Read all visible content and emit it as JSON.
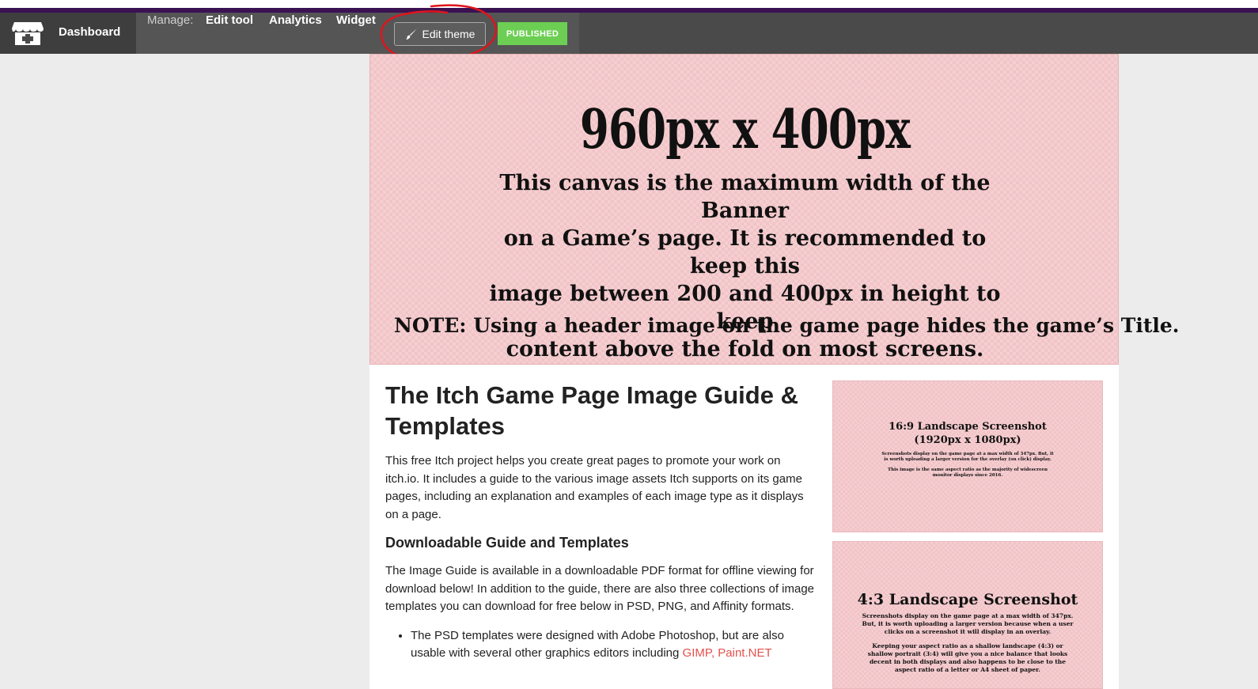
{
  "navbar": {
    "dashboard": "Dashboard",
    "manage_label": "Manage:",
    "edit_tool": "Edit tool",
    "analytics": "Analytics",
    "widget": "Widget",
    "edit_theme": "Edit theme",
    "status": "PUBLISHED"
  },
  "banner": {
    "title": "960px x 400px",
    "line1": "This canvas is the maximum width of the  Banner",
    "line2": "on a Game’s page. It is recommended to keep this",
    "line3": "image between 200 and 400px in height to keep",
    "line4": "content above the fold on most screens.",
    "note": "NOTE: Using a header image on the game page hides the game’s Title."
  },
  "content": {
    "title": "The Itch Game Page Image Guide & Templates",
    "intro": "This free Itch project helps you create great pages to promote your work on itch.io. It includes a guide to the various image assets Itch supports on its game pages, including an explanation and examples of each image type as it displays on a page.",
    "subheading": "Downloadable Guide and Templates",
    "para2": "The Image Guide is available in a downloadable PDF format for offline viewing for download below! In addition to the guide, there are also three collections of image templates you can download for free below in PSD, PNG, and Affinity formats.",
    "bullet1_text": "The PSD templates were designed with Adobe Photoshop, but are also usable with several other graphics editors including ",
    "bullet1_link1": "GIMP",
    "bullet1_sep": ", ",
    "bullet1_link2": "Paint.NET"
  },
  "screenshots": [
    {
      "title_line1": "16:9 Landscape Screenshot",
      "title_line2": "(1920px x 1080px)",
      "small1": "Screenshots display on the game page at a max width of 347px. But, it",
      "small2": "is worth uploading a larger version for the overlay (on click) display.",
      "small3": "This image is the same aspect ratio as the majority of widescreen",
      "small4": "monitor displays since 2016."
    },
    {
      "title_line1": "4:3 Landscape Screenshot",
      "small1": "Screenshots display on the game page at a max width of 347px.",
      "small2": "But, it is worth uploading a larger version because when a user",
      "small3": "clicks on a screenshot it will display in an overlay.",
      "small4": "Keeping your aspect ratio as a shallow landscape (4:3) or",
      "small5": "shallow portrait (3:4) will give you a nice balance that looks",
      "small6": "decent in both displays and also happens to be close to the",
      "small7": "aspect ratio of a letter or A4 sheet of paper."
    }
  ],
  "colors": {
    "navbar": "#4a4a4a",
    "accent_bar": "#3a1252",
    "published": "#6ccf54",
    "banner_pink": "#f2c4c7",
    "link": "#e2524d",
    "annotation": "#e0141c"
  },
  "icons": {
    "logo": "itch-logo-icon",
    "brush": "paintbrush-icon"
  }
}
